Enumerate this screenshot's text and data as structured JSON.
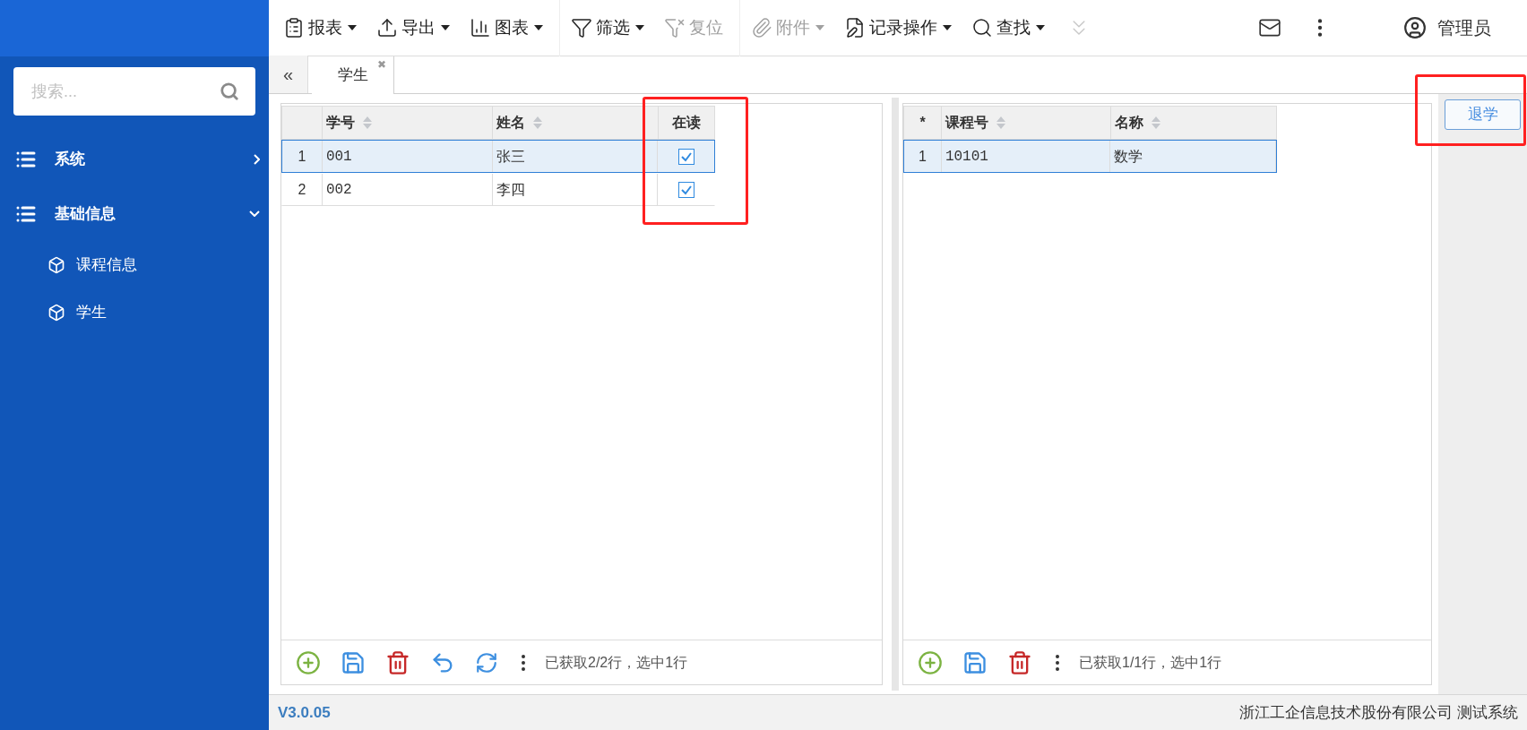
{
  "toolbar": [
    {
      "label": "报表",
      "dropdown": true,
      "disabled": false
    },
    {
      "label": "导出",
      "dropdown": true,
      "disabled": false
    },
    {
      "label": "图表",
      "dropdown": true,
      "disabled": false
    },
    {
      "label": "筛选",
      "dropdown": true,
      "disabled": false
    },
    {
      "label": "复位",
      "dropdown": false,
      "disabled": true
    },
    {
      "label": "附件",
      "dropdown": true,
      "disabled": true
    },
    {
      "label": "记录操作",
      "dropdown": true,
      "disabled": false
    },
    {
      "label": "查找",
      "dropdown": true,
      "disabled": false
    }
  ],
  "user": {
    "name": "管理员"
  },
  "sidebar": {
    "search": {
      "placeholder": "搜索..."
    },
    "items": [
      {
        "label": "系统",
        "expanded": false
      },
      {
        "label": "基础信息",
        "expanded": true,
        "children": [
          {
            "label": "课程信息"
          },
          {
            "label": "学生"
          }
        ]
      }
    ]
  },
  "tab_strip": {
    "collapse": "«",
    "tabs": [
      {
        "label": "学生",
        "close": "✖",
        "selected": true
      }
    ]
  },
  "left_grid": {
    "columns": [
      {
        "sortable": false
      },
      {
        "label": "学号",
        "sortable": true
      },
      {
        "label": "姓名",
        "sortable": true
      },
      {
        "label": "在读",
        "sortable": false
      }
    ],
    "rows": [
      {
        "cells": [
          "1",
          "001",
          "张三"
        ],
        "checked": true,
        "selected": true
      },
      {
        "cells": [
          "2",
          "002",
          "李四"
        ],
        "checked": true,
        "selected": false
      }
    ],
    "status": "已获取2/2行，选中1行"
  },
  "right_grid": {
    "columns": [
      {
        "label": "*",
        "sortable": false
      },
      {
        "label": "课程号",
        "sortable": true
      },
      {
        "label": "名称",
        "sortable": true
      }
    ],
    "rows": [
      {
        "cells": [
          "1",
          "10101",
          "数学"
        ],
        "selected": true
      }
    ],
    "status": "已获取1/1行，选中1行"
  },
  "side_action": {
    "label": "退学"
  },
  "footer": {
    "version": "V3.0.05",
    "company": "浙江工企信息技术股份有限公司 测试系统"
  }
}
